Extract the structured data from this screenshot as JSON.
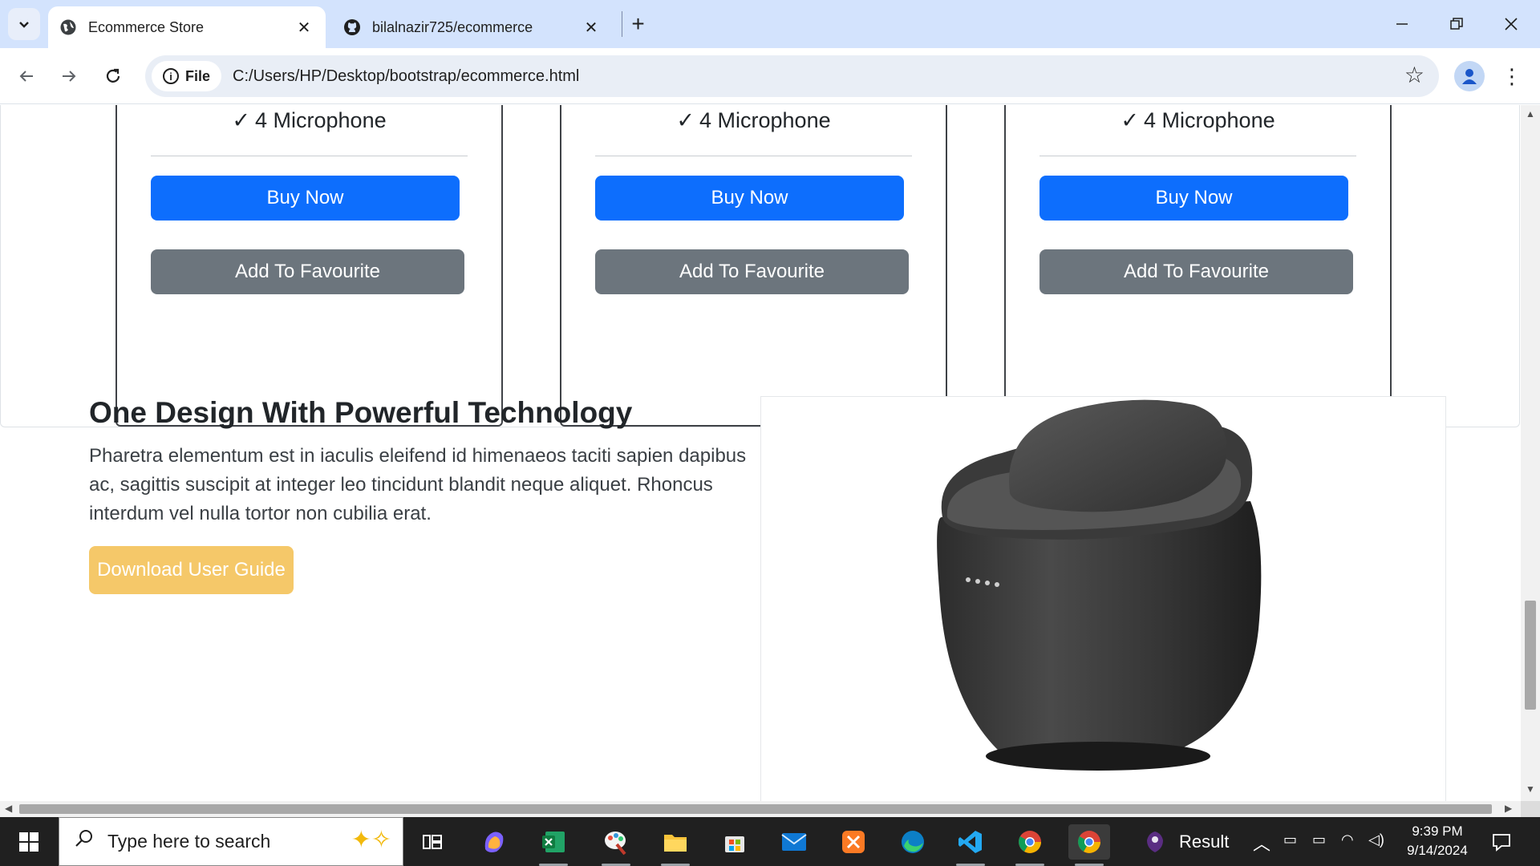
{
  "browser": {
    "tabs": [
      {
        "title": "Ecommerce Store",
        "favicon": "globe-icon",
        "active": true
      },
      {
        "title": "bilalnazir725/ecommerce",
        "favicon": "github-icon",
        "active": false
      }
    ],
    "new_tab_label": "+",
    "toolbar": {
      "site_chip": "File",
      "url": "C:/Users/HP/Desktop/bootstrap/ecommerce.html"
    }
  },
  "cards": [
    {
      "feature": "4 Microphone",
      "buy_label": "Buy Now",
      "fav_label": "Add To Favourite"
    },
    {
      "feature": "4 Microphone",
      "buy_label": "Buy Now",
      "fav_label": "Add To Favourite"
    },
    {
      "feature": "4 Microphone",
      "buy_label": "Buy Now",
      "fav_label": "Add To Favourite"
    }
  ],
  "feature_section": {
    "title": "One Design With Powerful Technology",
    "description": "Pharetra elementum est in iaculis eleifend id himenaeos taciti sapien dapibus ac, sagittis suscipit at integer leo tincidunt blandit neque aliquet. Rhoncus interdum vel nulla tortor non cubilia erat.",
    "button_label": "Download User Guide",
    "image": "smart-speaker-image"
  },
  "colors": {
    "primary": "#0d6efd",
    "secondary": "#6c757d",
    "warning": "#f5c869"
  },
  "taskbar": {
    "search_placeholder": "Type here to search",
    "apps": [
      "task-view-icon",
      "copilot-icon",
      "excel-icon",
      "paint-icon",
      "file-explorer-icon",
      "microsoft-store-icon",
      "mail-icon",
      "xampp-icon",
      "edge-icon",
      "vscode-icon",
      "chrome-icon",
      "chrome-active-icon"
    ],
    "result_label": "Result",
    "time": "9:39 PM",
    "date": "9/14/2024"
  }
}
